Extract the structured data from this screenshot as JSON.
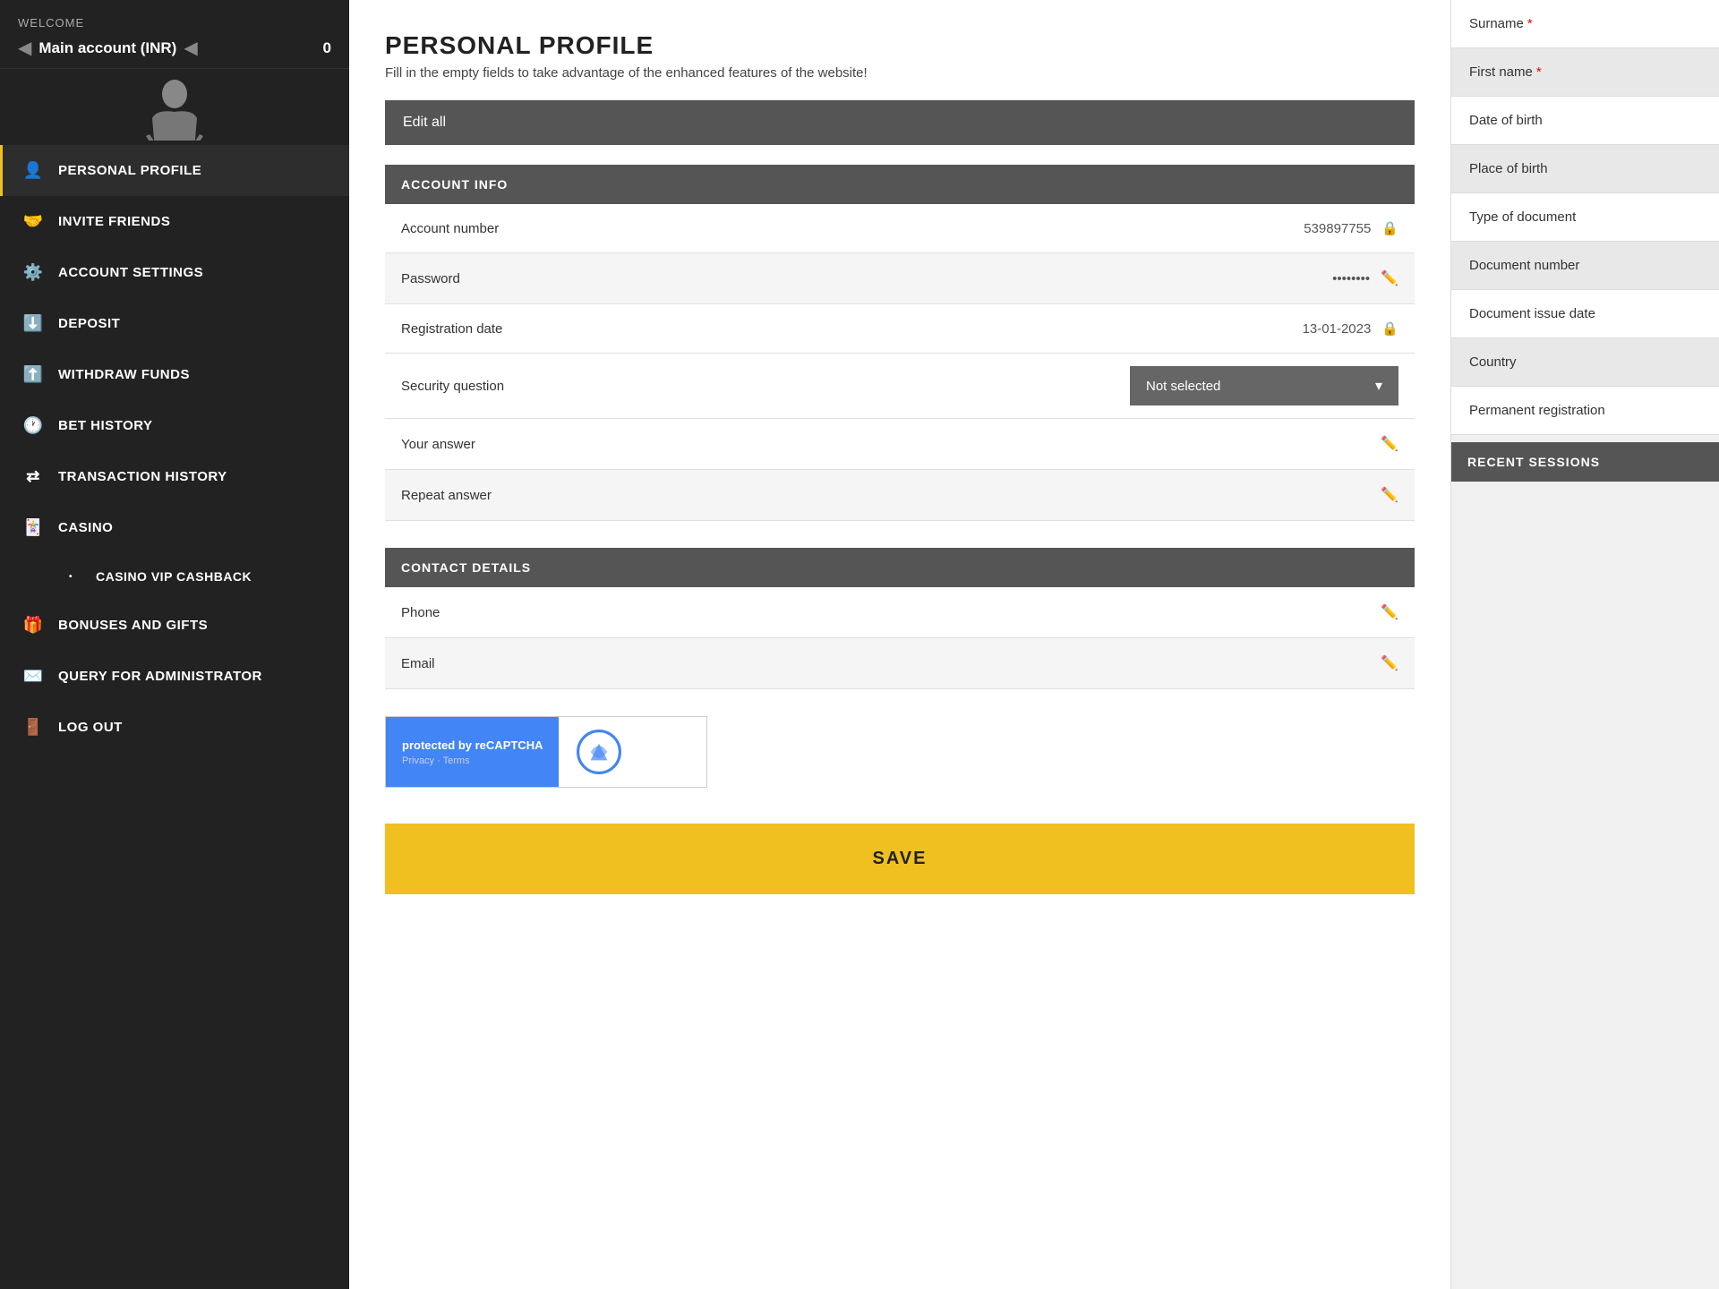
{
  "sidebar": {
    "welcome_label": "WELCOME",
    "account_name": "Main account (INR)",
    "balance": "0",
    "nav_items": [
      {
        "id": "personal-profile",
        "label": "PERSONAL PROFILE",
        "icon": "👤",
        "active": true,
        "sub": false
      },
      {
        "id": "invite-friends",
        "label": "INVITE FRIENDS",
        "icon": "🤝",
        "active": false,
        "sub": false
      },
      {
        "id": "account-settings",
        "label": "ACCOUNT SETTINGS",
        "icon": "⚙️",
        "active": false,
        "sub": false
      },
      {
        "id": "deposit",
        "label": "DEPOSIT",
        "icon": "⬇️",
        "active": false,
        "sub": false
      },
      {
        "id": "withdraw-funds",
        "label": "WITHDRAW FUNDS",
        "icon": "⬆️",
        "active": false,
        "sub": false
      },
      {
        "id": "bet-history",
        "label": "BET HISTORY",
        "icon": "🕐",
        "active": false,
        "sub": false
      },
      {
        "id": "transaction-history",
        "label": "TRANSACTION HISTORY",
        "icon": "⇄",
        "active": false,
        "sub": false
      },
      {
        "id": "casino",
        "label": "CASINO",
        "icon": "🃏",
        "active": false,
        "sub": false
      },
      {
        "id": "casino-vip",
        "label": "CASINO VIP CASHBACK",
        "icon": "•",
        "active": false,
        "sub": true
      },
      {
        "id": "bonuses",
        "label": "BONUSES AND GIFTS",
        "icon": "🎁",
        "active": false,
        "sub": false
      },
      {
        "id": "query-admin",
        "label": "QUERY FOR ADMINISTRATOR",
        "icon": "✉️",
        "active": false,
        "sub": false
      },
      {
        "id": "log-out",
        "label": "LOG OUT",
        "icon": "🚪",
        "active": false,
        "sub": false
      }
    ]
  },
  "main": {
    "page_title": "PERSONAL PROFILE",
    "page_subtitle": "Fill in the empty fields to take advantage of the enhanced features of the website!",
    "edit_all_label": "Edit all",
    "account_info": {
      "section_title": "ACCOUNT INFO",
      "fields": [
        {
          "label": "Account number",
          "value": "539897755",
          "icon": "lock",
          "shaded": false
        },
        {
          "label": "Password",
          "value": "********",
          "icon": "edit",
          "shaded": true
        },
        {
          "label": "Registration date",
          "value": "13-01-2023",
          "icon": "lock",
          "shaded": false
        },
        {
          "label": "Security question",
          "value": "Not selected",
          "icon": "dropdown",
          "shaded": true
        },
        {
          "label": "Your answer",
          "value": "",
          "icon": "edit",
          "shaded": false
        },
        {
          "label": "Repeat answer",
          "value": "",
          "icon": "edit",
          "shaded": true
        }
      ]
    },
    "contact_details": {
      "section_title": "CONTACT DETAILS",
      "fields": [
        {
          "label": "Phone",
          "value": "",
          "icon": "edit",
          "shaded": false
        },
        {
          "label": "Email",
          "value": "",
          "icon": "edit",
          "shaded": true
        }
      ]
    },
    "recaptcha": {
      "protected_by": "protected by reCAPTCHA",
      "links": "Privacy · Terms"
    },
    "save_label": "SAVE"
  },
  "right_panel": {
    "fields": [
      {
        "label": "Surname",
        "required": true,
        "shaded": false
      },
      {
        "label": "First name",
        "required": true,
        "shaded": true
      },
      {
        "label": "Date of birth",
        "required": false,
        "shaded": false
      },
      {
        "label": "Place of birth",
        "required": false,
        "shaded": true
      },
      {
        "label": "Type of document",
        "required": false,
        "shaded": false
      },
      {
        "label": "Document number",
        "required": false,
        "shaded": true
      },
      {
        "label": "Document issue date",
        "required": false,
        "shaded": false
      },
      {
        "label": "Country",
        "required": false,
        "shaded": true
      },
      {
        "label": "Permanent registration",
        "required": false,
        "shaded": false
      }
    ],
    "recent_sessions_label": "RECENT SESSIONS"
  }
}
